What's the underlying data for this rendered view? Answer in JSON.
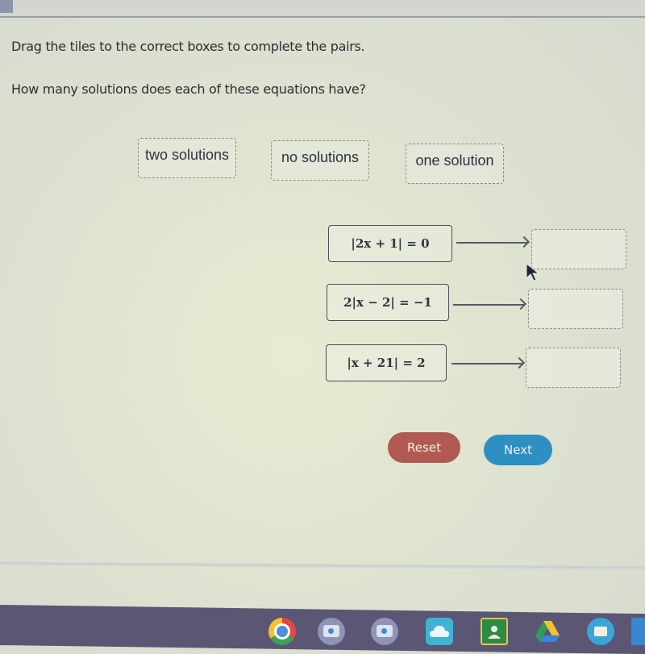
{
  "instructions": {
    "line1": "Drag the tiles to the correct boxes to complete the pairs.",
    "line2": "How many solutions does each of these equations have?"
  },
  "tiles": [
    {
      "label": "two solutions"
    },
    {
      "label": "no solutions"
    },
    {
      "label": "one solution"
    }
  ],
  "pairs": [
    {
      "equation": "|2x + 1| = 0",
      "answer": ""
    },
    {
      "equation": "2|x − 2| = −1",
      "answer": ""
    },
    {
      "equation": "|x + 21| = 2",
      "answer": ""
    }
  ],
  "buttons": {
    "reset_label": "Reset",
    "next_label": "Next"
  },
  "colors": {
    "reset": "#b05a52",
    "next": "#2e8fc3",
    "taskbar": "#5a5674"
  },
  "taskbar": {
    "icons": [
      "chrome-icon",
      "camera-icon",
      "camera-icon",
      "cloud-icon",
      "google-classroom-icon",
      "google-drive-icon",
      "meet-icon",
      "extra-app-icon"
    ]
  }
}
